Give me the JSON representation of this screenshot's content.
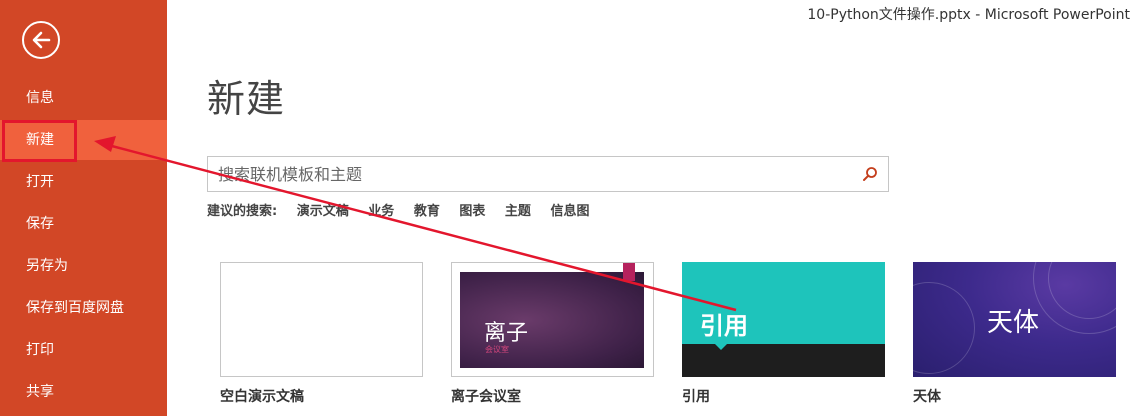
{
  "window": {
    "title": "10-Python文件操作.pptx - Microsoft PowerPoint"
  },
  "sidebar": {
    "back_icon": "arrow-left-icon",
    "items": [
      {
        "label": "信息"
      },
      {
        "label": "新建",
        "active": true
      },
      {
        "label": "打开"
      },
      {
        "label": "保存"
      },
      {
        "label": "另存为"
      },
      {
        "label": "保存到百度网盘"
      },
      {
        "label": "打印"
      },
      {
        "label": "共享"
      }
    ]
  },
  "main": {
    "title": "新建",
    "search": {
      "placeholder": "搜索联机模板和主题",
      "value": "",
      "icon": "search-icon"
    },
    "suggestions": {
      "label": "建议的搜索:",
      "items": [
        "演示文稿",
        "业务",
        "教育",
        "图表",
        "主题",
        "信息图"
      ]
    },
    "templates": [
      {
        "name": "空白演示文稿",
        "thumb_text": "",
        "thumb_sub": ""
      },
      {
        "name": "离子会议室",
        "thumb_text": "离子",
        "thumb_sub": "会议室"
      },
      {
        "name": "引用",
        "thumb_text": "引用",
        "thumb_sub": ""
      },
      {
        "name": "天体",
        "thumb_text": "天体",
        "thumb_sub": ""
      }
    ]
  },
  "colors": {
    "sidebar": "#d24726",
    "sidebar_active": "#f0613d",
    "annotation_red": "#e3162d",
    "quote_teal": "#1ec4bb",
    "ion_purple": "#3e2148",
    "celestial_blue": "#3d2a8c"
  }
}
